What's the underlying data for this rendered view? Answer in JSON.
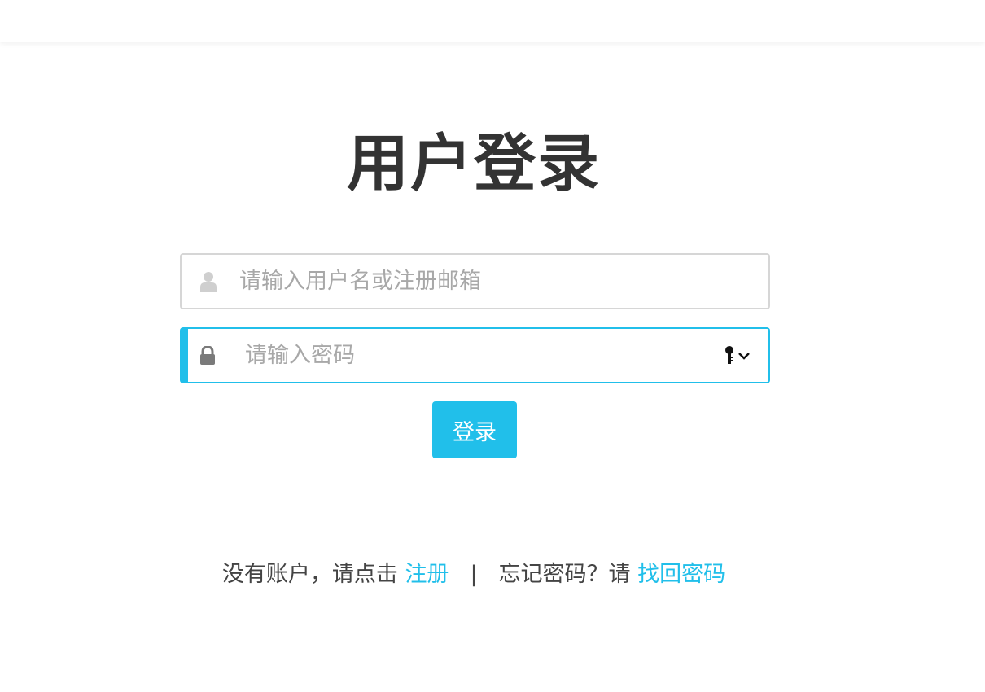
{
  "page": {
    "title": "用户登录"
  },
  "form": {
    "username": {
      "placeholder": "请输入用户名或注册邮箱",
      "value": "",
      "icon": "user-icon"
    },
    "password": {
      "placeholder": "请输入密码",
      "value": "",
      "icon": "lock-icon",
      "suffix_icon": "key-dropdown-icon"
    },
    "submit_label": "登录"
  },
  "footer": {
    "no_account_text": "没有账户，请点击",
    "register_link": "注册",
    "separator": "|",
    "forgot_text": "忘记密码？请",
    "recover_link": "找回密码"
  },
  "colors": {
    "accent": "#21bfea",
    "title": "#333333",
    "placeholder": "#a8a8a8",
    "border": "#d6d6d6"
  }
}
